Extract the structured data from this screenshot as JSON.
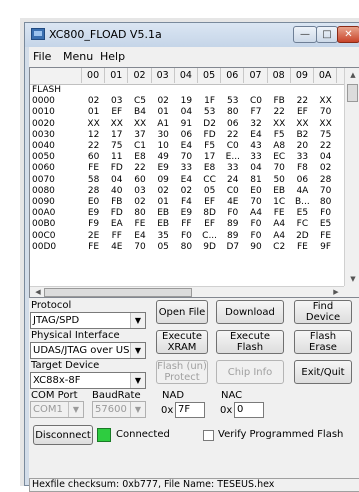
{
  "window": {
    "title": "XC800_FLOAD V5.1a"
  },
  "menu": [
    "File",
    "Menu",
    "Help"
  ],
  "grid": {
    "columns": [
      "00",
      "01",
      "02",
      "03",
      "04",
      "05",
      "06",
      "07",
      "08",
      "09",
      "0A"
    ],
    "section": "FLASH",
    "rows": [
      {
        "addr": "0000",
        "cells": [
          "02",
          "03",
          "C5",
          "02",
          "19",
          "1F",
          "53",
          "C0",
          "FB",
          "22",
          "XX"
        ]
      },
      {
        "addr": "0010",
        "cells": [
          "01",
          "EF",
          "B4",
          "01",
          "04",
          "53",
          "80",
          "F7",
          "22",
          "EF",
          "70"
        ]
      },
      {
        "addr": "0020",
        "cells": [
          "XX",
          "XX",
          "XX",
          "A1",
          "91",
          "D2",
          "06",
          "32",
          "XX",
          "XX",
          "XX"
        ]
      },
      {
        "addr": "0030",
        "cells": [
          "12",
          "17",
          "37",
          "30",
          "06",
          "FD",
          "22",
          "E4",
          "F5",
          "B2",
          "75"
        ]
      },
      {
        "addr": "0040",
        "cells": [
          "22",
          "75",
          "C1",
          "10",
          "E4",
          "F5",
          "C0",
          "43",
          "A8",
          "20",
          "22"
        ]
      },
      {
        "addr": "0050",
        "cells": [
          "60",
          "11",
          "E8",
          "49",
          "70",
          "17",
          "E...",
          "33",
          "EC",
          "33",
          "04"
        ]
      },
      {
        "addr": "0060",
        "cells": [
          "FE",
          "FD",
          "22",
          "E9",
          "33",
          "E8",
          "33",
          "04",
          "70",
          "F8",
          "02"
        ]
      },
      {
        "addr": "0070",
        "cells": [
          "58",
          "04",
          "60",
          "09",
          "E4",
          "CC",
          "24",
          "81",
          "50",
          "06",
          "28"
        ]
      },
      {
        "addr": "0080",
        "cells": [
          "28",
          "40",
          "03",
          "02",
          "02",
          "05",
          "C0",
          "E0",
          "EB",
          "4A",
          "70"
        ]
      },
      {
        "addr": "0090",
        "cells": [
          "E0",
          "FB",
          "02",
          "01",
          "F4",
          "EF",
          "4E",
          "70",
          "1C",
          "B...",
          "80"
        ]
      },
      {
        "addr": "00A0",
        "cells": [
          "E9",
          "FD",
          "80",
          "EB",
          "E9",
          "8D",
          "F0",
          "A4",
          "FE",
          "E5",
          "F0"
        ]
      },
      {
        "addr": "00B0",
        "cells": [
          "F9",
          "EA",
          "FE",
          "EB",
          "FF",
          "EF",
          "89",
          "F0",
          "A4",
          "FC",
          "E5"
        ]
      },
      {
        "addr": "00C0",
        "cells": [
          "2E",
          "FF",
          "E4",
          "35",
          "F0",
          "C...",
          "89",
          "F0",
          "A4",
          "2D",
          "FE"
        ]
      },
      {
        "addr": "00D0",
        "cells": [
          "FE",
          "4E",
          "70",
          "05",
          "80",
          "9D",
          "D7",
          "90",
          "C2",
          "FE",
          "9F"
        ]
      }
    ]
  },
  "protocol": {
    "label": "Protocol",
    "value": "JTAG/SPD"
  },
  "physical_interface": {
    "label": "Physical Interface",
    "value": "UDAS/JTAG over USB"
  },
  "target_device": {
    "label": "Target Device",
    "value": "XC88x-8F"
  },
  "com_port": {
    "label": "COM Port",
    "value": "COM1"
  },
  "baud_rate": {
    "label": "BaudRate",
    "value": "57600"
  },
  "nad": {
    "label": "NAD",
    "prefix": "0x",
    "value": "7F"
  },
  "nac": {
    "label": "NAC",
    "prefix": "0x",
    "value": "0"
  },
  "buttons": {
    "open_file": "Open File",
    "download": "Download",
    "find_device": "Find Device",
    "execute_xram": "Execute XRAM",
    "execute_flash": "Execute Flash",
    "flash_erase": "Flash Erase",
    "flash_protect": "Flash (un) Protect",
    "chip_info": "Chip Info",
    "exit_quit": "Exit/Quit",
    "disconnect": "Disconnect"
  },
  "connection": {
    "status": "Connected",
    "indicator_color": "#2ecc40"
  },
  "verify": {
    "label": "Verify Programmed Flash",
    "checked": false
  },
  "statusbar": {
    "text": "Hexfile checksum: 0xb777,  File Name: TESEUS.hex"
  }
}
